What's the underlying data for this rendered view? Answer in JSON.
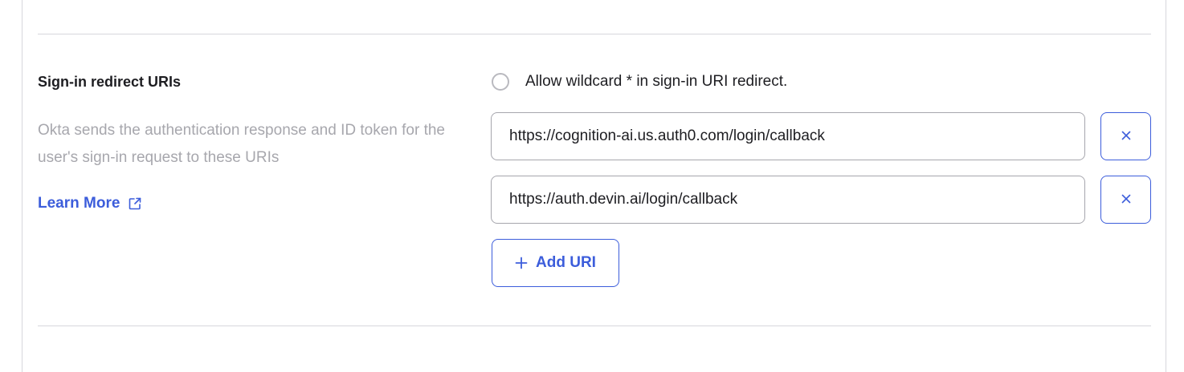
{
  "section": {
    "title": "Sign-in redirect URIs",
    "description": "Okta sends the authentication response and ID token for the user's sign-in request to these URIs",
    "learn_more_label": "Learn More",
    "learn_more_icon": "external-link-icon"
  },
  "wildcard": {
    "checked": false,
    "label": "Allow wildcard * in sign-in URI redirect."
  },
  "uris": [
    {
      "value": "https://cognition-ai.us.auth0.com/login/callback",
      "remove_icon": "close-icon"
    },
    {
      "value": "https://auth.devin.ai/login/callback",
      "remove_icon": "close-icon"
    }
  ],
  "add_button": {
    "label": "Add URI",
    "icon": "plus-icon"
  },
  "colors": {
    "accent": "#3c5ddb",
    "muted_text": "#a7a7ad",
    "border": "#d7d7dc",
    "text": "#1d1d21"
  }
}
